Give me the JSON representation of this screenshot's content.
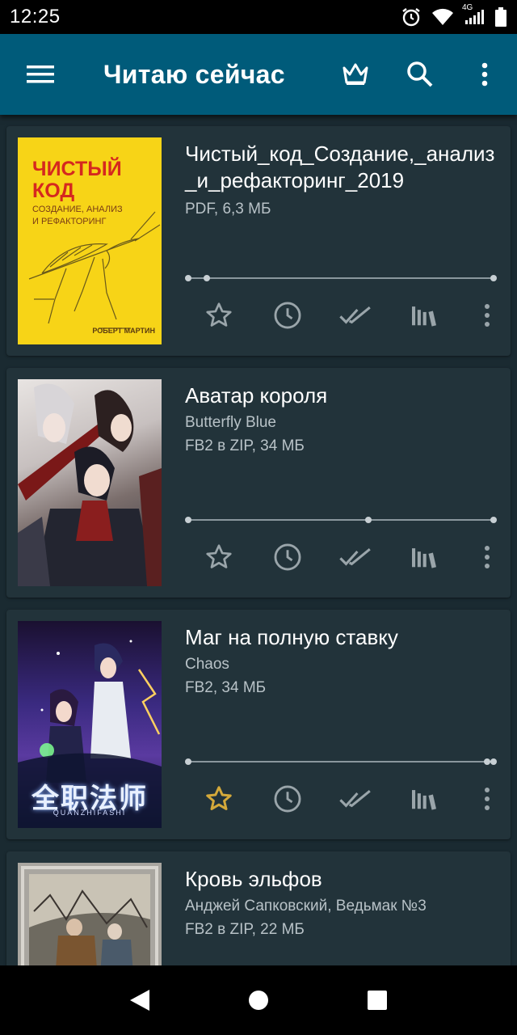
{
  "status_bar": {
    "time": "12:25",
    "network_label": "4G"
  },
  "toolbar": {
    "title": "Читаю сейчас",
    "accent_color": "#005b7a"
  },
  "books": [
    {
      "title": "Чистый_код_Создание,_анализ_и_рефакторинг_2019",
      "author": "",
      "meta": "PDF, 6,3 МБ",
      "progress": 0.06,
      "favorite": false,
      "cover": {
        "title_line1": "ЧИСТЫЙ",
        "title_line2": "КОД",
        "subtitle_line1": "СОЗДАНИЕ, АНАЛИЗ",
        "subtitle_line2": "И РЕФАКТОРИНГ",
        "author": "РОБЕРТ МАРТИН"
      }
    },
    {
      "title": "Аватар короля",
      "author": "Butterfly Blue",
      "meta": "FB2 в ZIP, 34 МБ",
      "progress": 0.59,
      "favorite": false
    },
    {
      "title": "Маг на полную ставку",
      "author": "Chaos",
      "meta": "FB2, 34 МБ",
      "progress": 0.98,
      "favorite": true,
      "cover": {
        "title": "全职法师",
        "subtitle": "QUANZHIFASHI"
      }
    },
    {
      "title": "Кровь эльфов",
      "author": "Анджей Сапковский, Ведьмак №3",
      "meta": "FB2 в ZIP, 22 МБ",
      "progress": null,
      "favorite": false
    }
  ],
  "colors": {
    "background": "#1a2a31",
    "card": "#22333a",
    "icon": "#9aa5aa",
    "favorite_star": "#d4a93a"
  }
}
